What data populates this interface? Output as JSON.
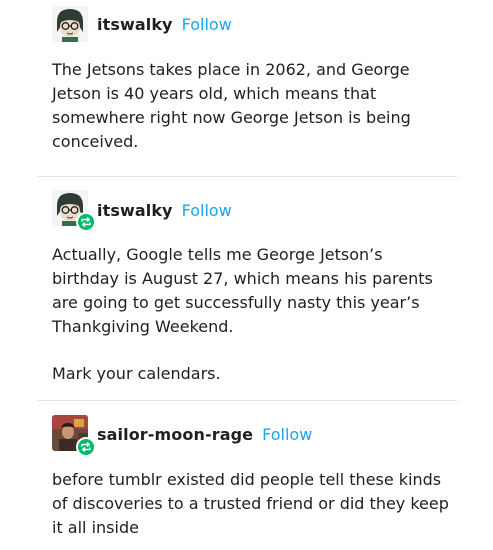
{
  "posts": [
    {
      "username": "itswalky",
      "follow_label": "Follow",
      "reblog": false,
      "avatar_icon": "comic-character-avatar-icon",
      "paragraphs": [
        "The Jetsons takes place in 2062, and George Jetson is 40 years old, which means that somewhere right now George Jetson is being conceived."
      ]
    },
    {
      "username": "itswalky",
      "follow_label": "Follow",
      "reblog": true,
      "avatar_icon": "comic-character-avatar-icon",
      "paragraphs": [
        "Actually, Google tells me George Jetson’s birthday is August 27, which means his parents are going to get successfully nasty this year’s Thankgiving Weekend.",
        "Mark your calendars."
      ]
    },
    {
      "username": "sailor-moon-rage",
      "follow_label": "Follow",
      "reblog": true,
      "avatar_icon": "photo-avatar-icon",
      "paragraphs": [
        "before tumblr existed did people tell these kinds of discoveries to a trusted friend or did they keep it all inside"
      ]
    }
  ],
  "colors": {
    "follow": "#1aa7e8",
    "reblog_badge": "#00b86b",
    "text": "#1f1f1f",
    "divider": "#e3e3e3"
  }
}
